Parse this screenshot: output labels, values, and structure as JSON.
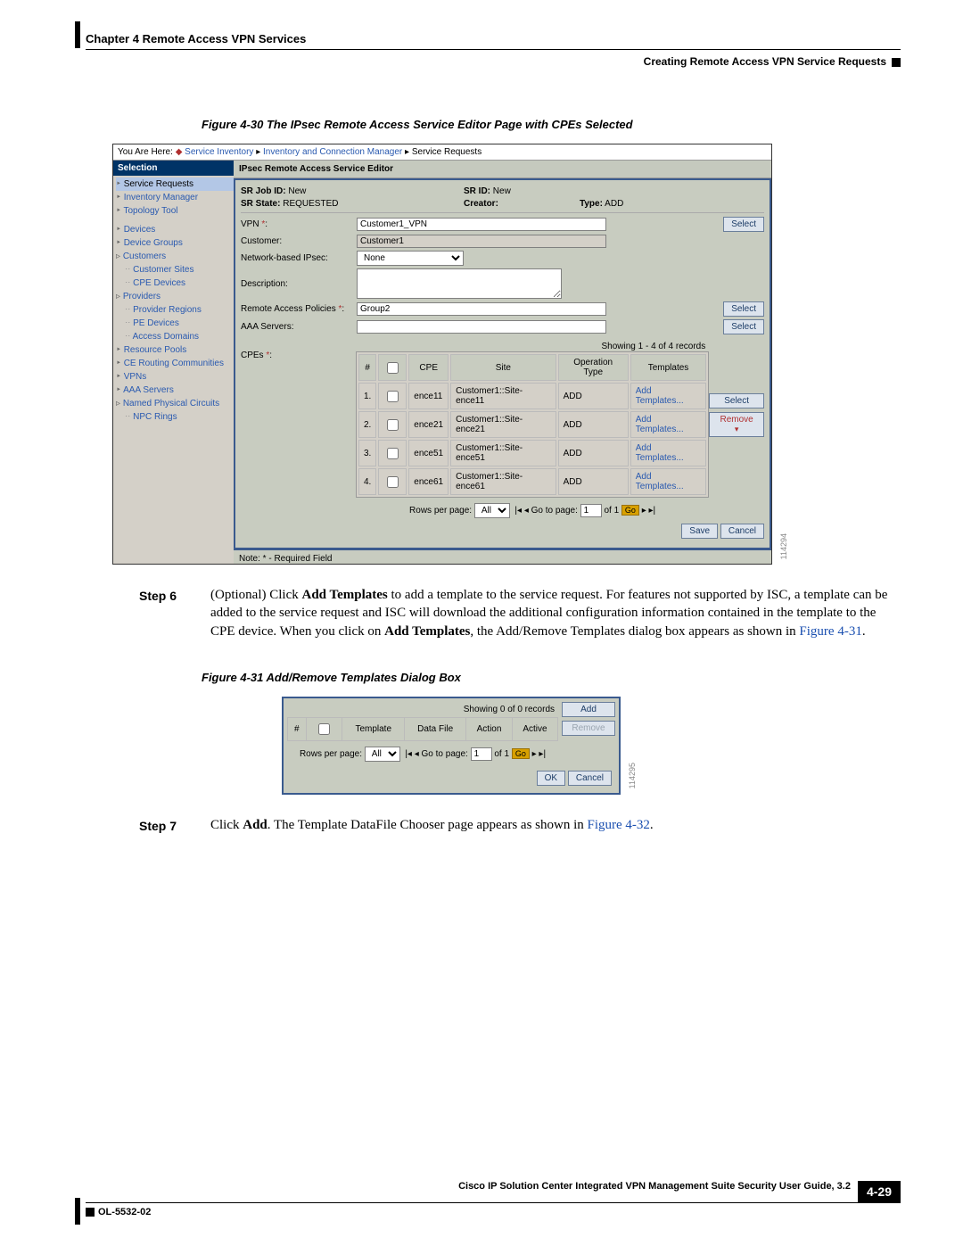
{
  "header": {
    "chapter": "Chapter 4      Remote Access VPN Services",
    "section": "Creating Remote Access VPN Service Requests"
  },
  "fig30": {
    "caption": "Figure 4-30   The IPsec Remote Access Service Editor Page with CPEs Selected",
    "breadcrumb_prefix": "You Are Here: ",
    "bc_dot": "◆",
    "bc1": "Service Inventory",
    "bc2": "Inventory and Connection Manager",
    "bc3": "Service Requests",
    "selection_title": "Selection",
    "nav": {
      "sr": "Service Requests",
      "im": "Inventory Manager",
      "tt": "Topology Tool",
      "dev": "Devices",
      "dg": "Device Groups",
      "cust": "Customers",
      "cs": "Customer Sites",
      "cpe": "CPE Devices",
      "prov": "Providers",
      "pr": "Provider Regions",
      "pe": "PE Devices",
      "ad": "Access Domains",
      "rp": "Resource Pools",
      "cerc": "CE Routing Communities",
      "vpns": "VPNs",
      "aaa": "AAA Servers",
      "npc": "Named Physical Circuits",
      "rings": "NPC Rings"
    },
    "editor_title": "IPsec Remote Access Service Editor",
    "fields": {
      "sr_job_label": "SR Job ID:",
      "sr_job_value": "New",
      "sr_state_label": "SR State:",
      "sr_state_value": "REQUESTED",
      "sr_id_label": "SR ID:",
      "sr_id_value": "New",
      "creator_label": "Creator:",
      "type_label": "Type:",
      "type_value": "ADD",
      "vpn_label": "VPN",
      "vpn_value": "Customer1_VPN",
      "customer_label": "Customer:",
      "customer_value": "Customer1",
      "ipsec_label": "Network-based IPsec:",
      "ipsec_value": "None",
      "desc_label": "Description:",
      "rap_label": "Remote Access Policies",
      "rap_value": "Group2",
      "aaa_label": "AAA Servers:",
      "cpes_label": "CPEs"
    },
    "select_btn": "Select",
    "remove_btn": "Remove",
    "cpe_table": {
      "count": "Showing 1 - 4 of 4 records",
      "hdr_num": "#",
      "hdr_cpe": "CPE",
      "hdr_site": "Site",
      "hdr_op": "Operation Type",
      "hdr_tmpl": "Templates",
      "rows": [
        {
          "n": "1.",
          "cpe": "ence11",
          "site": "Customer1::Site-ence11",
          "op": "ADD",
          "t": "Add Templates..."
        },
        {
          "n": "2.",
          "cpe": "ence21",
          "site": "Customer1::Site-ence21",
          "op": "ADD",
          "t": "Add Templates..."
        },
        {
          "n": "3.",
          "cpe": "ence51",
          "site": "Customer1::Site-ence51",
          "op": "ADD",
          "t": "Add Templates..."
        },
        {
          "n": "4.",
          "cpe": "ence61",
          "site": "Customer1::Site-ence61",
          "op": "ADD",
          "t": "Add Templates..."
        }
      ]
    },
    "pager": {
      "rpp": "Rows per page:",
      "all": "All",
      "go": "Go to page:",
      "page": "1",
      "of": "of 1",
      "gobtn": "Go"
    },
    "save": "Save",
    "cancel": "Cancel",
    "note": "Note: * - Required Field",
    "imgno": "114294"
  },
  "step6": {
    "label": "Step 6",
    "text_a": "(Optional) Click ",
    "bold_a": "Add Templates",
    "text_b": " to add a template to the service request. For features not supported by ISC, a template can be added to the service request and ISC will download the additional configuration information contained in the template to the CPE device. When you click on ",
    "bold_b": "Add Templates",
    "text_c": ", the Add/Remove Templates dialog box appears as shown in ",
    "figref": "Figure 4-31",
    "text_d": "."
  },
  "fig31": {
    "caption": "Figure 4-31   Add/Remove Templates Dialog Box",
    "count": "Showing 0 of 0 records",
    "hdr_num": "#",
    "hdr_tmpl": "Template",
    "hdr_df": "Data File",
    "hdr_act": "Action",
    "hdr_active": "Active",
    "add": "Add",
    "remove": "Remove",
    "ok": "OK",
    "cancel": "Cancel",
    "pager": {
      "rpp": "Rows per page:",
      "all": "All",
      "go": "Go to page:",
      "page": "1",
      "of": "of 1",
      "gobtn": "Go"
    },
    "imgno": "114295"
  },
  "step7": {
    "label": "Step 7",
    "text_a": "Click ",
    "bold_a": "Add",
    "text_b": ". The Template DataFile Chooser page appears as shown in ",
    "figref": "Figure 4-32",
    "text_c": "."
  },
  "footer": {
    "title": "Cisco IP Solution Center Integrated VPN Management Suite Security User Guide, 3.2",
    "ol": "OL-5532-02",
    "pagenum": "4-29"
  }
}
